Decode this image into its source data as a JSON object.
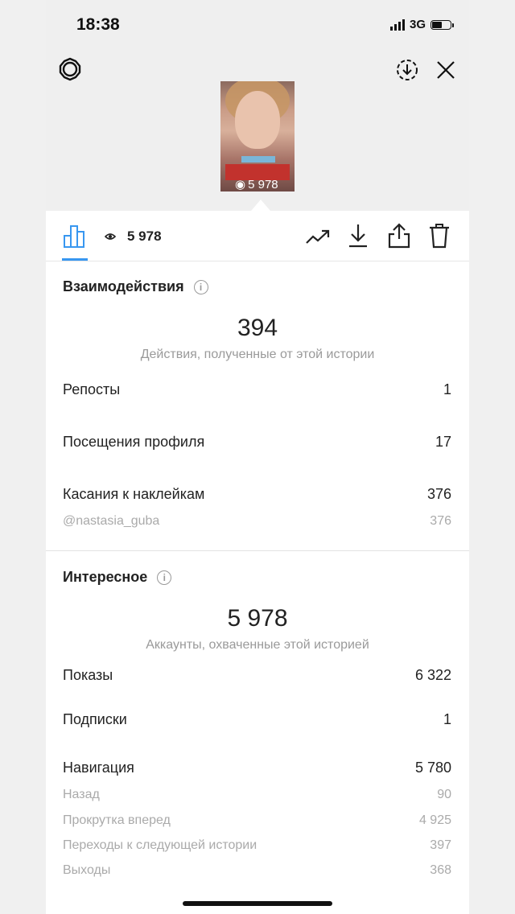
{
  "status": {
    "time": "18:38",
    "network": "3G"
  },
  "header": {
    "settings_icon": "gear-icon",
    "save_icon": "download-circle-icon",
    "close_icon": "close-icon"
  },
  "story": {
    "view_count": "5 978",
    "thumb_view_count": "5 978"
  },
  "tabs": {
    "insights_icon": "bar-chart-icon",
    "eye_icon": "eye-icon"
  },
  "actions": [
    "trending-icon",
    "download-icon",
    "share-icon",
    "trash-icon"
  ],
  "interactions": {
    "title": "Взаимодействия",
    "total": "394",
    "caption": "Действия, полученные от этой истории",
    "rows": [
      {
        "label": "Репосты",
        "value": "1"
      },
      {
        "label": "Посещения профиля",
        "value": "17"
      },
      {
        "label": "Касания к наклейкам",
        "value": "376"
      }
    ],
    "sub": {
      "label": "@nastasia_guba",
      "value": "376"
    }
  },
  "discovery": {
    "title": "Интересное",
    "total": "5 978",
    "caption": "Аккаунты, охваченные этой историей",
    "rows": [
      {
        "label": "Показы",
        "value": "6 322"
      },
      {
        "label": "Подписки",
        "value": "1"
      },
      {
        "label": "Навигация",
        "value": "5 780"
      }
    ],
    "nav_sub": [
      {
        "label": "Назад",
        "value": "90"
      },
      {
        "label": "Прокрутка вперед",
        "value": "4 925"
      },
      {
        "label": "Переходы к следующей истории",
        "value": "397"
      },
      {
        "label": "Выходы",
        "value": "368"
      }
    ]
  }
}
